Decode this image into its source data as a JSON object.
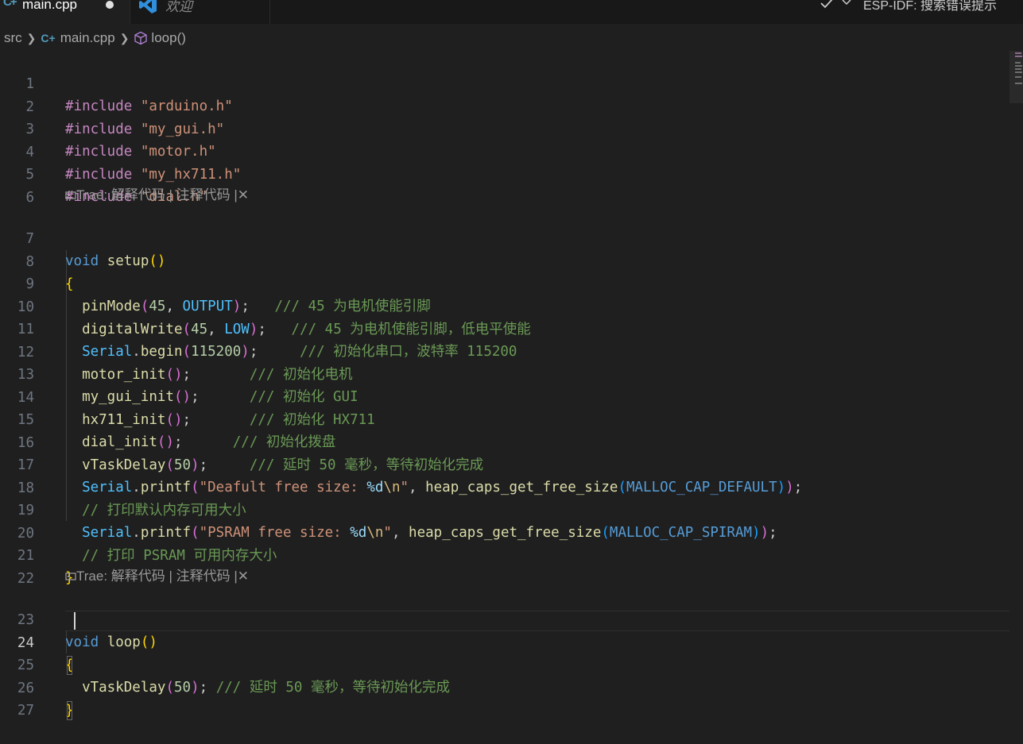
{
  "tabs": [
    {
      "label": "main.cpp",
      "icon": "cpp-file-icon",
      "active": true,
      "dirty": true
    },
    {
      "label": "欢迎",
      "icon": "vscode-icon",
      "active": false
    }
  ],
  "toolbar": {
    "status_text": "ESP-IDF: 搜索错误提示"
  },
  "breadcrumb": {
    "folder": "src",
    "file": "main.cpp",
    "symbol": "loop()"
  },
  "codelens": {
    "text": "Trae: 解释代码 | 注释代码 |",
    "close": "✕"
  },
  "editor": {
    "active_line": 24,
    "line_numbers": [
      "1",
      "2",
      "3",
      "4",
      "5",
      "6",
      "7",
      "8",
      "9",
      "10",
      "11",
      "12",
      "13",
      "14",
      "15",
      "16",
      "17",
      "18",
      "19",
      "20",
      "21",
      "22",
      "23",
      "24",
      "25",
      "26",
      "27"
    ]
  },
  "code": {
    "l1": {
      "kw": "#include",
      "str": "\"arduino.h\""
    },
    "l2": {
      "kw": "#include",
      "str": "\"my_gui.h\""
    },
    "l3": {
      "kw": "#include",
      "str": "\"motor.h\""
    },
    "l4": {
      "kw": "#include",
      "str": "\"my_hx711.h\""
    },
    "l5": {
      "kw": "#include",
      "str": "\"dial.h\""
    },
    "l7": {
      "type": "void",
      "name": "setup"
    },
    "l9": {
      "fn": "pinMode",
      "num": "45",
      "arg": "OUTPUT",
      "comment": "/// 45 为电机使能引脚"
    },
    "l10": {
      "fn": "digitalWrite",
      "num": "45",
      "arg": "LOW",
      "comment": "/// 45 为电机使能引脚，低电平使能"
    },
    "l11": {
      "obj": "Serial",
      "fn": "begin",
      "num": "115200",
      "comment": "/// 初始化串口，波特率 115200"
    },
    "l12": {
      "fn": "motor_init",
      "comment": "/// 初始化电机"
    },
    "l13": {
      "fn": "my_gui_init",
      "comment": "/// 初始化 GUI"
    },
    "l14": {
      "fn": "hx711_init",
      "comment": "/// 初始化 HX711"
    },
    "l15": {
      "fn": "dial_init",
      "comment": "/// 初始化拨盘"
    },
    "l16": {
      "fn": "vTaskDelay",
      "num": "50",
      "comment": "/// 延时 50 毫秒，等待初始化完成"
    },
    "l17": {
      "obj": "Serial",
      "fn": "printf",
      "s1": "\"Deafult free size: ",
      "ph": "%d",
      "esc": "\\n",
      "s2": "\"",
      "fn2": "heap_caps_get_free_size",
      "macro": "MALLOC_CAP_DEFAULT"
    },
    "l18": {
      "comment": "// 打印默认内存可用大小"
    },
    "l19": {
      "obj": "Serial",
      "fn": "printf",
      "s1": "\"PSRAM free size: ",
      "ph": "%d",
      "esc": "\\n",
      "s2": "\"",
      "fn2": "heap_caps_get_free_size",
      "macro": "MALLOC_CAP_SPIRAM"
    },
    "l20": {
      "comment": "// 打印 PSRAM 可用内存大小"
    },
    "l23": {
      "type": "void",
      "name": "loop"
    },
    "l25": {
      "fn": "vTaskDelay",
      "num": "50",
      "comment": "/// 延时 50 毫秒，等待初始化完成"
    }
  }
}
